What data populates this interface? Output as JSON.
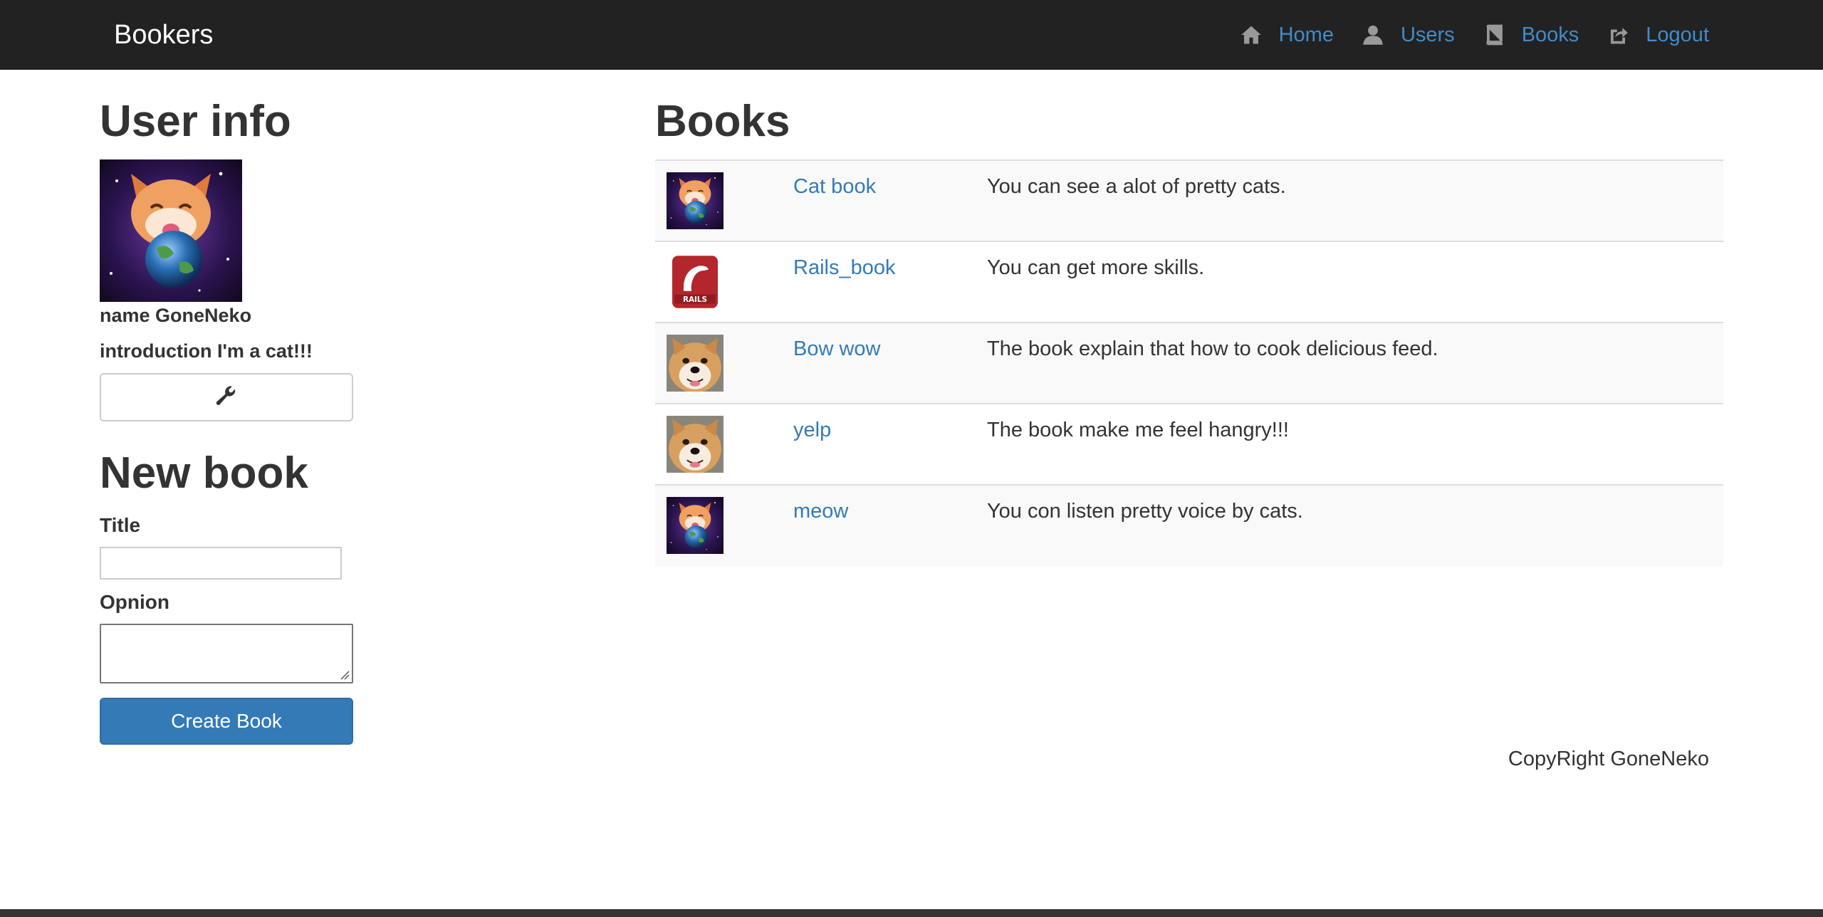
{
  "navbar": {
    "brand": "Bookers",
    "items": [
      {
        "label": "Home",
        "icon": "home-icon"
      },
      {
        "label": "Users",
        "icon": "user-icon"
      },
      {
        "label": "Books",
        "icon": "book-icon"
      },
      {
        "label": "Logout",
        "icon": "logout-icon"
      }
    ]
  },
  "user_info": {
    "heading": "User info",
    "name_line": "name GoneNeko",
    "intro_line": "introduction I'm a cat!!!",
    "edit_icon": "wrench-icon"
  },
  "new_book": {
    "heading": "New book",
    "title_label": "Title",
    "title_value": "",
    "opinion_label": "Opnion",
    "opinion_value": "",
    "submit_label": "Create Book"
  },
  "books": {
    "heading": "Books",
    "rows": [
      {
        "thumb": "cat-space",
        "title": "Cat book",
        "opinion": "You can see a alot of pretty cats."
      },
      {
        "thumb": "rails",
        "title": "Rails_book",
        "opinion": "You can get more skills."
      },
      {
        "thumb": "shiba",
        "title": "Bow wow",
        "opinion": "The book explain that how to cook delicious feed."
      },
      {
        "thumb": "shiba",
        "title": "yelp",
        "opinion": "The book make me feel hangry!!!"
      },
      {
        "thumb": "cat-space",
        "title": "meow",
        "opinion": "You con listen pretty voice by cats."
      }
    ]
  },
  "footer": {
    "copyright": "CopyRight GoneNeko"
  },
  "colors": {
    "navbar_bg": "#222222",
    "link": "#337ab7",
    "primary_button": "#337ab7",
    "row_stripe": "#f9f9f9"
  }
}
